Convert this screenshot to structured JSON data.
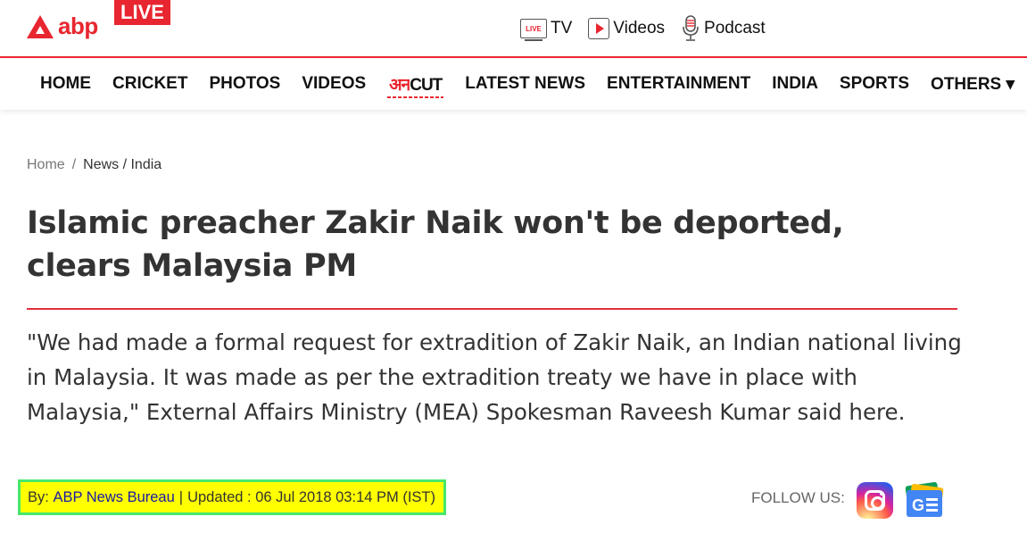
{
  "header": {
    "logo_text": "abp",
    "live_badge": "LIVE",
    "live_icon_text": "LIVE",
    "media_links": [
      {
        "label": "TV",
        "icon": "live-tv-icon"
      },
      {
        "label": "Videos",
        "icon": "play-icon"
      },
      {
        "label": "Podcast",
        "icon": "microphone-icon"
      }
    ]
  },
  "nav": {
    "items": [
      "HOME",
      "CRICKET",
      "PHOTOS",
      "VIDEOS"
    ],
    "unkut_devanagari": "अन",
    "unkut_latin": "CUT",
    "items_after": [
      "LATEST NEWS",
      "ENTERTAINMENT",
      "INDIA",
      "SPORTS",
      "OTHERS"
    ],
    "others_arrow": "▾"
  },
  "breadcrumb": {
    "home": "Home",
    "separator": "/",
    "path": "News / India"
  },
  "article": {
    "headline": "Islamic preacher Zakir Naik won't be deported, clears Malaysia PM",
    "summary": "\"We had made a formal request for extradition of Zakir Naik, an Indian national living in Malaysia. It was made as per the extradition treaty we have in place with Malaysia,\" External Affairs Ministry (MEA) Spokesman Raveesh Kumar said here.",
    "byline_prefix": "By:",
    "author": "ABP News Bureau",
    "divider": "|",
    "updated": "Updated : 06 Jul 2018 03:14 PM (IST)"
  },
  "follow": {
    "label": "FOLLOW US:",
    "icons": [
      "instagram-icon",
      "google-news-icon"
    ]
  },
  "colors": {
    "brand_red": "#e8262f",
    "highlight_yellow": "#ffff00",
    "highlight_border": "#46e86b"
  }
}
